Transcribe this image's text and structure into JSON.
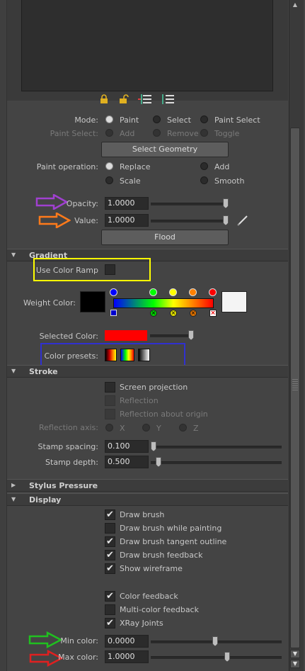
{
  "icons": [
    "lock-icon",
    "unlock-icon",
    "list-reset-icon",
    "list-icon",
    "pencil-icon"
  ],
  "mode": {
    "label": "Mode:",
    "options": [
      "Paint",
      "Select",
      "Paint Select"
    ]
  },
  "paint_select": {
    "label": "Paint Select:",
    "options": [
      "Add",
      "Remove",
      "Toggle"
    ]
  },
  "select_geometry_label": "Select Geometry",
  "paint_operation": {
    "label": "Paint operation:",
    "options": [
      "Replace",
      "Add",
      "Scale",
      "Smooth"
    ]
  },
  "opacity": {
    "label": "Opacity:",
    "value": "1.0000",
    "slider": 1.0
  },
  "value": {
    "label": "Value:",
    "value": "1.0000",
    "slider": 1.0
  },
  "flood_label": "Flood",
  "sections": {
    "gradient": "Gradient",
    "stroke": "Stroke",
    "stylus": "Stylus Pressure",
    "display": "Display"
  },
  "gradient": {
    "use_color_ramp": "Use Color Ramp",
    "weight_color": "Weight Color:",
    "selected_color": "Selected Color:",
    "color_presets": "Color presets:",
    "colors": {
      "selected": "#ff0000",
      "ramp_markers": [
        "#0000ff",
        "#00ff00",
        "#ffff00",
        "#ff8000",
        "#ff0000"
      ]
    }
  },
  "stroke": {
    "screen_projection": "Screen projection",
    "reflection": "Reflection",
    "reflection_about_origin": "Reflection about origin",
    "reflection_axis": {
      "label": "Reflection axis:",
      "options": [
        "X",
        "Y",
        "Z"
      ]
    },
    "stamp_spacing": {
      "label": "Stamp spacing:",
      "value": "0.100",
      "slider": 0.0
    },
    "stamp_depth": {
      "label": "Stamp depth:",
      "value": "0.500",
      "slider": 0.05
    }
  },
  "display": {
    "draw_brush": "Draw brush",
    "draw_brush_while_painting": "Draw brush while painting",
    "draw_brush_tangent_outline": "Draw brush tangent outline",
    "draw_brush_feedback": "Draw brush feedback",
    "show_wireframe": "Show wireframe",
    "color_feedback": "Color feedback",
    "multi_color_feedback": "Multi-color feedback",
    "xray_joints": "XRay Joints",
    "min_color": {
      "label": "Min color:",
      "value": "0.0000",
      "slider": 0.5
    },
    "max_color": {
      "label": "Max color:",
      "value": "1.0000",
      "slider": 0.59
    }
  },
  "annotation_colors": {
    "purple": "#a040d0",
    "orange": "#ff7a1a",
    "yellow": "#ffff00",
    "blue": "#3030d0",
    "green": "#20c020",
    "red": "#e02020"
  }
}
